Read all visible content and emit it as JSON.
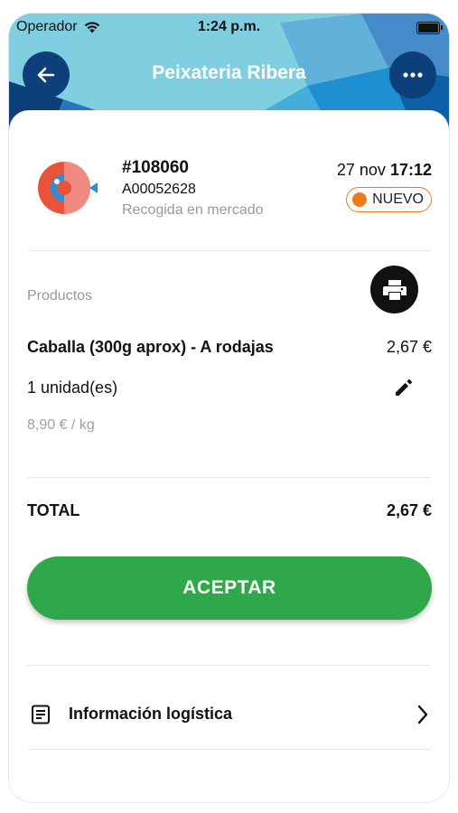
{
  "status_bar": {
    "carrier": "Operador",
    "time": "1:24 p.m."
  },
  "header": {
    "title": "Peixateria Ribera"
  },
  "order": {
    "number": "#108060",
    "code": "A00052628",
    "type": "Recogida en mercado",
    "date": "27 nov",
    "time": "17:12",
    "status": "NUEVO"
  },
  "products": {
    "label": "Productos",
    "items": [
      {
        "name": "Caballa (300g aprox) - A rodajas",
        "price": "2,67 €",
        "quantity": "1 unidad(es)",
        "unit_price": "8,90 € / kg"
      }
    ]
  },
  "total": {
    "label": "TOTAL",
    "value": "2,67 €"
  },
  "actions": {
    "accept_label": "ACEPTAR"
  },
  "logistics": {
    "label": "Información logística"
  },
  "colors": {
    "header_bg": "#7fcfe0",
    "header_button": "#0d3f7a",
    "accept_green": "#2ea84a",
    "status_orange": "#f07a1e"
  },
  "icons": [
    "wifi-icon",
    "battery-icon",
    "back-arrow-icon",
    "more-dots-icon",
    "fish-logo-icon",
    "print-icon",
    "edit-pencil-icon",
    "document-list-icon",
    "chevron-right-icon"
  ]
}
